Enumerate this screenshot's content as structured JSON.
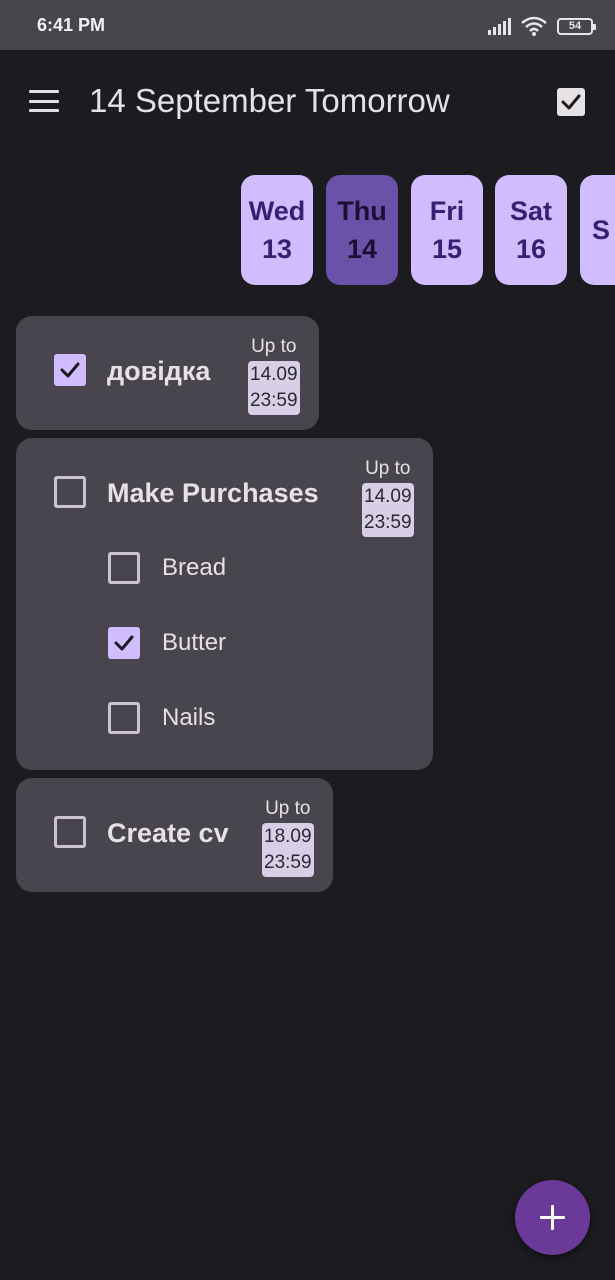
{
  "status_bar": {
    "time": "6:41 PM",
    "battery": "54"
  },
  "app_bar": {
    "title": "14 September Tomorrow"
  },
  "days": [
    {
      "name": "Wed",
      "num": "13",
      "selected": false
    },
    {
      "name": "Thu",
      "num": "14",
      "selected": true
    },
    {
      "name": "Fri",
      "num": "15",
      "selected": false
    },
    {
      "name": "Sat",
      "num": "16",
      "selected": false
    },
    {
      "name": "S",
      "num": "",
      "selected": false
    }
  ],
  "tasks": [
    {
      "title": "довідка",
      "checked": true,
      "due_label": "Up to",
      "due_date": "14.09",
      "due_time": "23:59",
      "subtasks": []
    },
    {
      "title": "Make Purchases",
      "checked": false,
      "due_label": "Up to",
      "due_date": "14.09",
      "due_time": "23:59",
      "subtasks": [
        {
          "label": "Bread",
          "checked": false
        },
        {
          "label": "Butter",
          "checked": true
        },
        {
          "label": "Nails",
          "checked": false
        }
      ]
    },
    {
      "title": "Create cv",
      "checked": false,
      "due_label": "Up to",
      "due_date": "18.09",
      "due_time": "23:59",
      "subtasks": []
    }
  ],
  "icons": {
    "menu": "menu-icon",
    "done_toggle": "checkbox-checked-icon",
    "add": "plus-icon",
    "signal": "signal-icon",
    "wifi": "wifi-icon",
    "battery": "battery-icon"
  },
  "colors": {
    "background": "#1c1b1f",
    "status_bar": "#48464c",
    "card": "#49454f",
    "chip": "#d0bcff",
    "chip_selected": "#6a52a8",
    "accent": "#d0bcff",
    "fab": "#6b3a99"
  }
}
